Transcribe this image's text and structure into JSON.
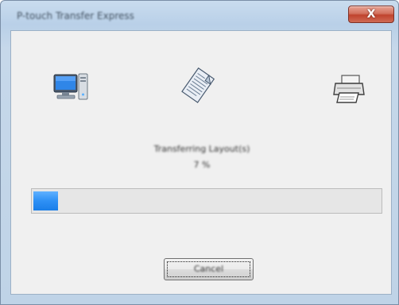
{
  "window": {
    "title": "P-touch Transfer Express",
    "close_glyph": "X",
    "accent_color": "#c0432e"
  },
  "transfer": {
    "source_icon": "computer-icon",
    "document_icon": "document-icon",
    "target_icon": "printer-icon",
    "status_text": "Transferring Layout(s)",
    "percent_text": "7 %",
    "progress_fraction": 0.07,
    "progress_color": "#2e90f5"
  },
  "buttons": {
    "cancel_label": "Cancel"
  }
}
